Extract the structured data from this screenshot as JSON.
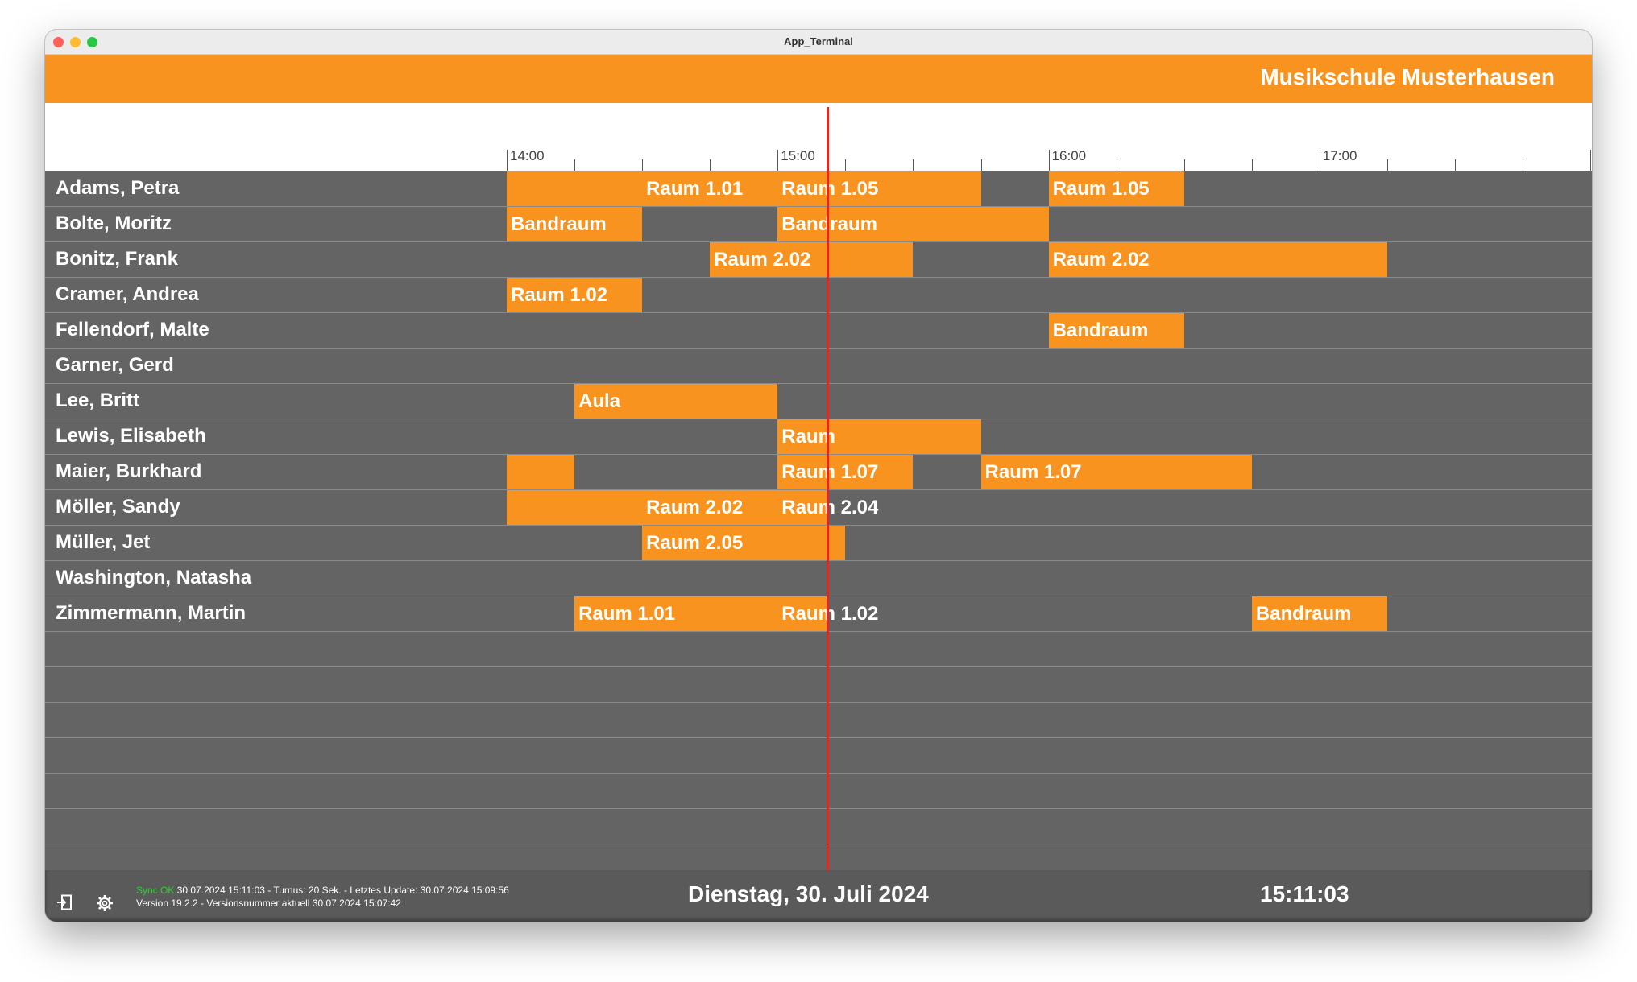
{
  "window": {
    "title": "App_Terminal"
  },
  "header": {
    "title": "Musikschule Musterhausen"
  },
  "timeline": {
    "hour_labels": [
      "14:00",
      "15:00",
      "16:00",
      "17:00"
    ],
    "start_minutes": 840,
    "end_minutes": 1105,
    "current_time_minutes": 911.05
  },
  "teachers": [
    {
      "name": "Adams, Petra",
      "lessons": [
        {
          "start": 840,
          "end": 870,
          "room": ""
        },
        {
          "start": 870,
          "end": 900,
          "room": "Raum 1.01"
        },
        {
          "start": 900,
          "end": 945,
          "room": "Raum 1.05"
        },
        {
          "start": 960,
          "end": 990,
          "room": "Raum 1.05"
        }
      ]
    },
    {
      "name": "Bolte, Moritz",
      "lessons": [
        {
          "start": 840,
          "end": 870,
          "room": "Bandraum"
        },
        {
          "start": 900,
          "end": 960,
          "room": "Bandraum"
        }
      ]
    },
    {
      "name": "Bonitz, Frank",
      "lessons": [
        {
          "start": 885,
          "end": 930,
          "room": "Raum 2.02"
        },
        {
          "start": 960,
          "end": 1035,
          "room": "Raum 2.02"
        }
      ]
    },
    {
      "name": "Cramer, Andrea",
      "lessons": [
        {
          "start": 840,
          "end": 870,
          "room": "Raum 1.02"
        }
      ]
    },
    {
      "name": "Fellendorf, Malte",
      "lessons": [
        {
          "start": 960,
          "end": 990,
          "room": "Bandraum"
        }
      ]
    },
    {
      "name": "Garner, Gerd",
      "lessons": []
    },
    {
      "name": "Lee, Britt",
      "lessons": [
        {
          "start": 855,
          "end": 900,
          "room": "Aula"
        }
      ]
    },
    {
      "name": "Lewis, Elisabeth",
      "lessons": [
        {
          "start": 900,
          "end": 945,
          "room": "Raum"
        }
      ]
    },
    {
      "name": "Maier, Burkhard",
      "lessons": [
        {
          "start": 840,
          "end": 855,
          "room": ""
        },
        {
          "start": 900,
          "end": 930,
          "room": "Raum 1.07"
        },
        {
          "start": 945,
          "end": 1005,
          "room": "Raum 1.07"
        }
      ]
    },
    {
      "name": "Möller, Sandy",
      "lessons": [
        {
          "start": 840,
          "end": 870,
          "room": ""
        },
        {
          "start": 870,
          "end": 900,
          "room": "Raum 2.02"
        },
        {
          "start": 900,
          "end": 911,
          "room": "Raum 2.04"
        }
      ]
    },
    {
      "name": "Müller, Jet",
      "lessons": [
        {
          "start": 870,
          "end": 915,
          "room": "Raum 2.05"
        }
      ]
    },
    {
      "name": "Washington, Natasha",
      "lessons": []
    },
    {
      "name": "Zimmermann, Martin",
      "lessons": [
        {
          "start": 855,
          "end": 900,
          "room": "Raum 1.01"
        },
        {
          "start": 900,
          "end": 911,
          "room": "Raum 1.02"
        },
        {
          "start": 1005,
          "end": 1035,
          "room": "Bandraum"
        }
      ]
    }
  ],
  "empty_rows": 7,
  "footer": {
    "sync_status": "Sync OK",
    "sync_info": "30.07.2024 15:11:03 - Turnus: 20 Sek. - Letztes Update: 30.07.2024 15:09:56",
    "version_info": "Version 19.2.2 - Versionsnummer aktuell 30.07.2024 15:07:42",
    "date": "Dienstag, 30. Juli 2024",
    "time": "15:11:03",
    "icons": [
      "logout-icon",
      "gear-icon"
    ]
  },
  "colors": {
    "accent": "#f7931e",
    "background": "#646464",
    "now_line": "#e8261c",
    "sync_ok": "#2bd12b"
  }
}
